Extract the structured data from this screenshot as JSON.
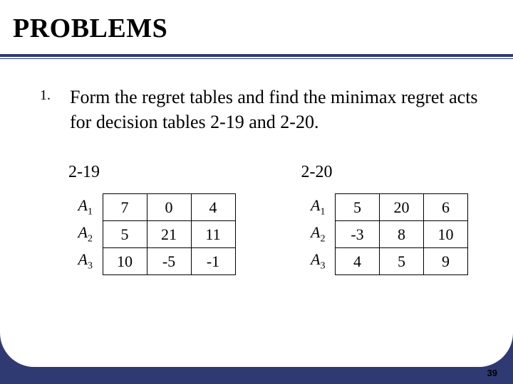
{
  "title": "PROBLEMS",
  "item": {
    "number": "1.",
    "text": "Form the regret tables and find the minimax regret acts for decision tables 2-19 and 2-20."
  },
  "table_left": {
    "label": "2-19",
    "rows": [
      {
        "name": "A",
        "sub": "1",
        "c1": "7",
        "c2": "0",
        "c3": "4"
      },
      {
        "name": "A",
        "sub": "2",
        "c1": "5",
        "c2": "21",
        "c3": "11"
      },
      {
        "name": "A",
        "sub": "3",
        "c1": "10",
        "c2": "-5",
        "c3": "-1"
      }
    ]
  },
  "table_right": {
    "label": "2-20",
    "rows": [
      {
        "name": "A",
        "sub": "1",
        "c1": "5",
        "c2": "20",
        "c3": "6"
      },
      {
        "name": "A",
        "sub": "2",
        "c1": "-3",
        "c2": "8",
        "c3": "10"
      },
      {
        "name": "A",
        "sub": "3",
        "c1": "4",
        "c2": "5",
        "c3": "9"
      }
    ]
  },
  "page_number": "39",
  "chart_data": [
    {
      "type": "table",
      "title": "2-19",
      "row_labels": [
        "A1",
        "A2",
        "A3"
      ],
      "values": [
        [
          7,
          0,
          4
        ],
        [
          5,
          21,
          11
        ],
        [
          10,
          -5,
          -1
        ]
      ]
    },
    {
      "type": "table",
      "title": "2-20",
      "row_labels": [
        "A1",
        "A2",
        "A3"
      ],
      "values": [
        [
          5,
          20,
          6
        ],
        [
          -3,
          8,
          10
        ],
        [
          4,
          5,
          9
        ]
      ]
    }
  ]
}
